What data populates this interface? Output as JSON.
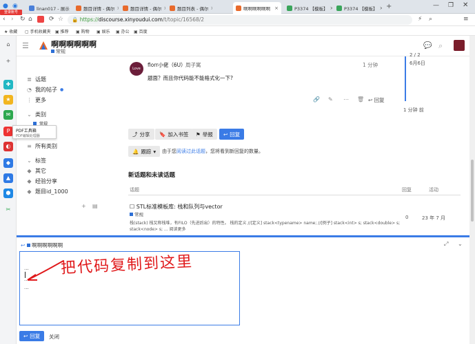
{
  "browser": {
    "tabs": [
      {
        "label": "linan017 - 展示",
        "color": "#4a7fd9"
      },
      {
        "label": "题目详情 - 偶尔",
        "color": "#e86a2c"
      },
      {
        "label": "题目详情 - 偶尔",
        "color": "#e86a2c"
      },
      {
        "label": "题目列表 - 偶尔",
        "color": "#e86a2c"
      },
      {
        "label": "啊啊啊啊啊啊",
        "color": "#e86a2c"
      },
      {
        "label": "P3374 【模板】",
        "color": "#3aa55b"
      },
      {
        "label": "P3374 【模板】",
        "color": "#3aa55b"
      }
    ],
    "url_prefix": "https://",
    "url_domain": "discourse.xinyoudui.com",
    "url_path": "/t/topic/16568/2",
    "bookmarks": [
      "收藏",
      "手机收藏夹",
      "推荐",
      "购物",
      "娱乐",
      "办公",
      "百度"
    ],
    "login_badge": "登录账号"
  },
  "sidebar_tooltip": {
    "title": "PDF工具箱",
    "sub": "PDF编辑处理器"
  },
  "header": {
    "title": "啊啊啊啊啊啊",
    "category": "常规"
  },
  "sidebar": {
    "topics": "话题",
    "my_posts": "我的帖子",
    "more": "更多",
    "categories_header": "类别",
    "partial_item": "常规",
    "all_categories": "所有类别",
    "tags_header": "标签",
    "tags": [
      "其它",
      "经验分享",
      "题目id_1000"
    ]
  },
  "post": {
    "author": "florr小佬（6U）",
    "author_title": "周子寓",
    "time": "1 分钟",
    "body": "题面？而且你代码能不能格式化一下?",
    "reply": "回复",
    "avatar_text": "Love"
  },
  "timeline": {
    "count": "2 / 2",
    "date": "6月6日",
    "ago": "1 分钟 前"
  },
  "actions": {
    "share": "分享",
    "bookmark": "加入书签",
    "report": "举报",
    "reply": "回复"
  },
  "notify": {
    "level": "跟踪",
    "desc_pre": "由于您",
    "desc_link": "阅读过此话题",
    "desc_post": "，您将看到新回复的数量。"
  },
  "suggested": {
    "heading": "新话题和未读话题",
    "col_topic": "话题",
    "col_replies": "回复",
    "col_activity": "活动",
    "row_title": "STL标准模板库: 栈和队列与vector",
    "row_cat": "常规",
    "row_replies": "0",
    "row_activity": "23 年 7 月",
    "excerpt": "栈(stack) 栈又称栈堆，有FILO（先进后出）的特性。 栈的定义 //[定义] stack<typename> name; //[例子] stack<int> s; stack<double> s; stack<node> s; ... 阅读更多"
  },
  "composer": {
    "reply_to": "啊啊啊啊啊啊",
    "line1": "...",
    "line2": "...",
    "line3": "...",
    "annotation": "把代码复制到这里",
    "submit": "回复",
    "close": "关闭"
  }
}
